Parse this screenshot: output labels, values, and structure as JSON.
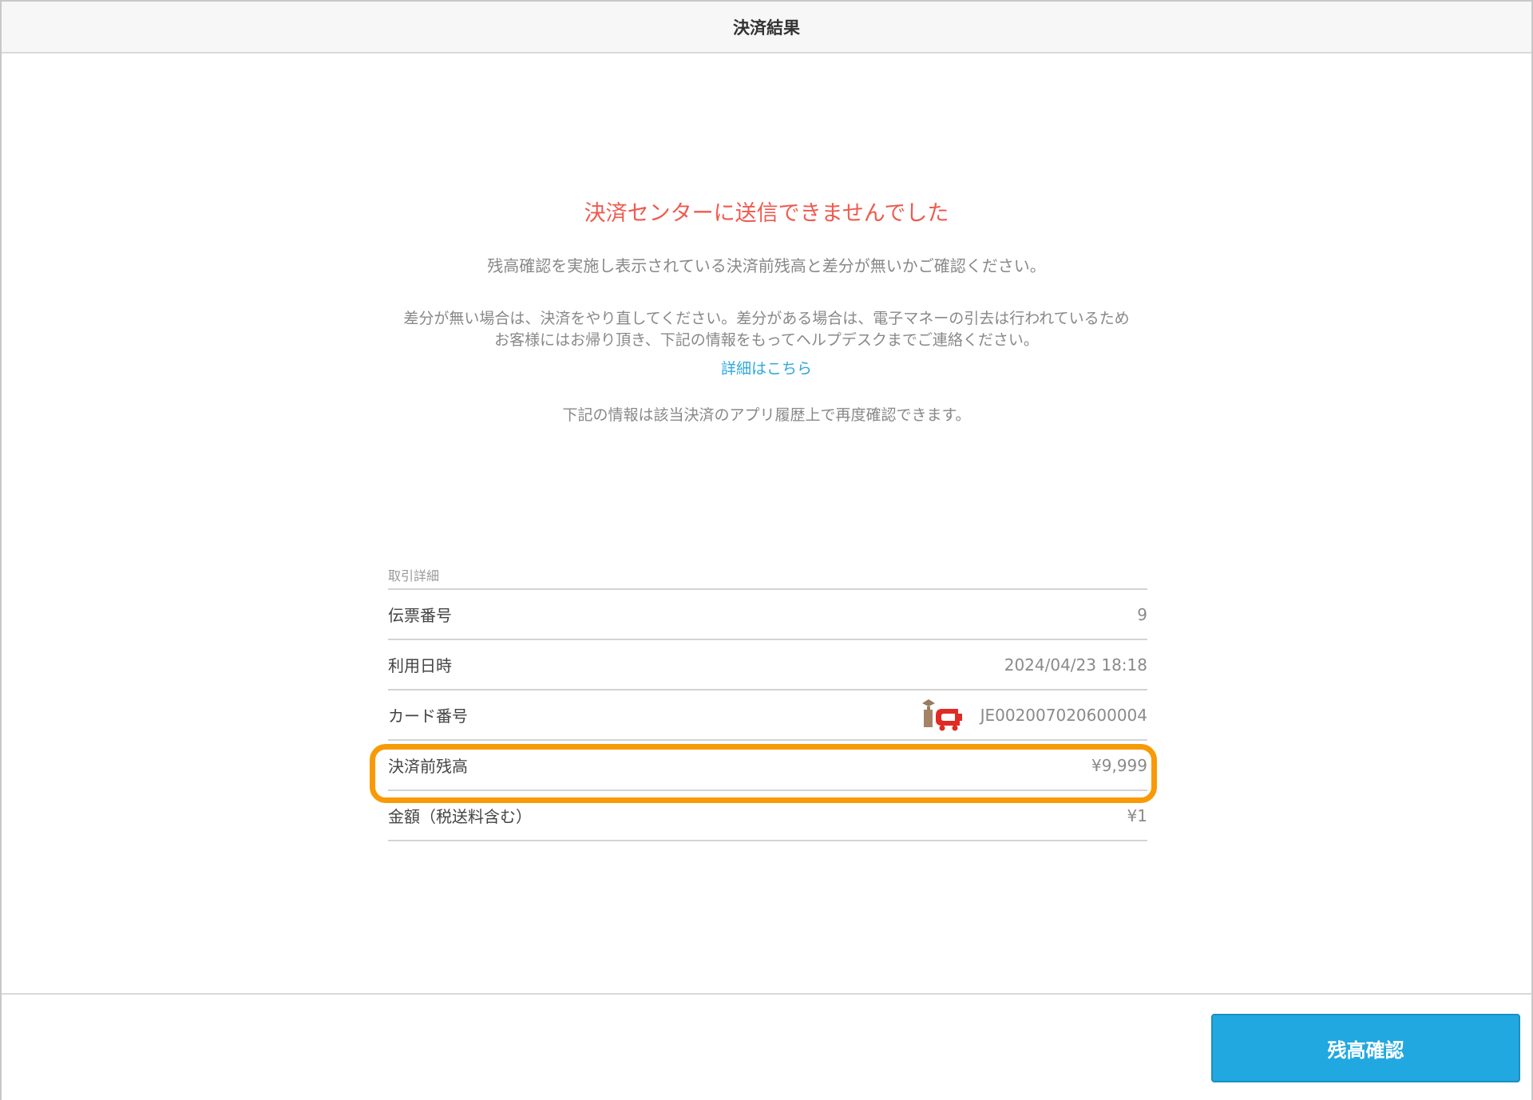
{
  "header": {
    "title": "決済結果"
  },
  "message": {
    "error_title": "決済センターに送信できませんでした",
    "line1": "残高確認を実施し表示されている決済前残高と差分が無いかご確認ください。",
    "line2a": "差分が無い場合は、決済をやり直してください。差分がある場合は、電子マネーの引去は行われているため",
    "line2b": "お客様にはお帰り頂き、下記の情報をもってヘルプデスクまでご連絡ください。",
    "detail_link": "詳細はこちら",
    "line3": "下記の情報は該当決済のアプリ履歴上で再度確認できます。"
  },
  "details": {
    "section_title": "取引詳細",
    "rows": [
      {
        "label": "伝票番号",
        "value": "9"
      },
      {
        "label": "利用日時",
        "value": "2024/04/23 18:18"
      },
      {
        "label": "カード番号",
        "value": "JE002007020600004",
        "icon": "ic-card-logo-icon"
      },
      {
        "label": "決済前残高",
        "value": "¥9,999",
        "highlighted": true
      },
      {
        "label": "金額（税送料含む）",
        "value": "¥1"
      }
    ]
  },
  "colors": {
    "error": "#ef5a4f",
    "link": "#2ea8dc",
    "highlight": "#f89a06",
    "button": "#22a8e0"
  },
  "footer": {
    "confirm_button": "残高確認"
  }
}
